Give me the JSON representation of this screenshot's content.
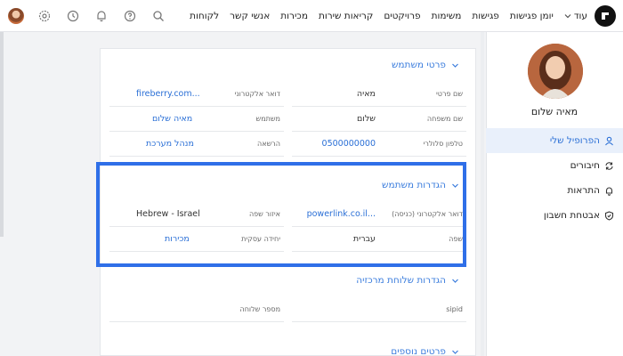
{
  "nav": {
    "items": [
      "לקוחות",
      "אנשי קשר",
      "מכירות",
      "קריאות שירות",
      "פרויקטים",
      "משימות",
      "פגישות",
      "יומן פגישות"
    ],
    "more": "עוד"
  },
  "sidebar": {
    "name": "מאיה שלום",
    "items": [
      {
        "label": "הפרופיל שלי",
        "icon": "user-icon"
      },
      {
        "label": "חיבורים",
        "icon": "sync-icon"
      },
      {
        "label": "התראות",
        "icon": "bell-icon"
      },
      {
        "label": "אבטחת חשבון",
        "icon": "shield-icon"
      }
    ]
  },
  "sections": {
    "user_details": {
      "title": "פרטי משתמש",
      "rows": [
        {
          "r_label": "שם פרטי",
          "r_value": "מאיה",
          "l_label": "דואר אלקטרוני",
          "l_value": "fireberry.com..."
        },
        {
          "r_label": "שם משפחה",
          "r_value": "שלום",
          "l_label": "משתמש",
          "l_value": "מאיה שלום"
        },
        {
          "r_label": "טלפון סלולרי",
          "r_value": "0500000000",
          "l_label": "הרשאה",
          "l_value": "מנהל מערכת"
        }
      ]
    },
    "user_settings": {
      "title": "הגדרות משתמש",
      "rows": [
        {
          "r_label": "דואר אלקטרוני (כניסה)",
          "r_value": "powerlink.co.il...",
          "l_label": "איזור שפה",
          "l_value": "Hebrew - Israel"
        },
        {
          "r_label": "שפה",
          "r_value": "עברית",
          "l_label": "יחידה עסקית",
          "l_value": "מכירות"
        }
      ]
    },
    "central_settings": {
      "title": "הגדרות שלוחת מרכזיה",
      "rows": [
        {
          "r_label": "sipid",
          "r_value": "",
          "l_label": "מספר שלוחה",
          "l_value": ""
        }
      ]
    },
    "more_details": {
      "title": "פרטים נוספים"
    }
  },
  "colors": {
    "accent": "#2a6fd6",
    "highlight": "#2f6fe8"
  }
}
